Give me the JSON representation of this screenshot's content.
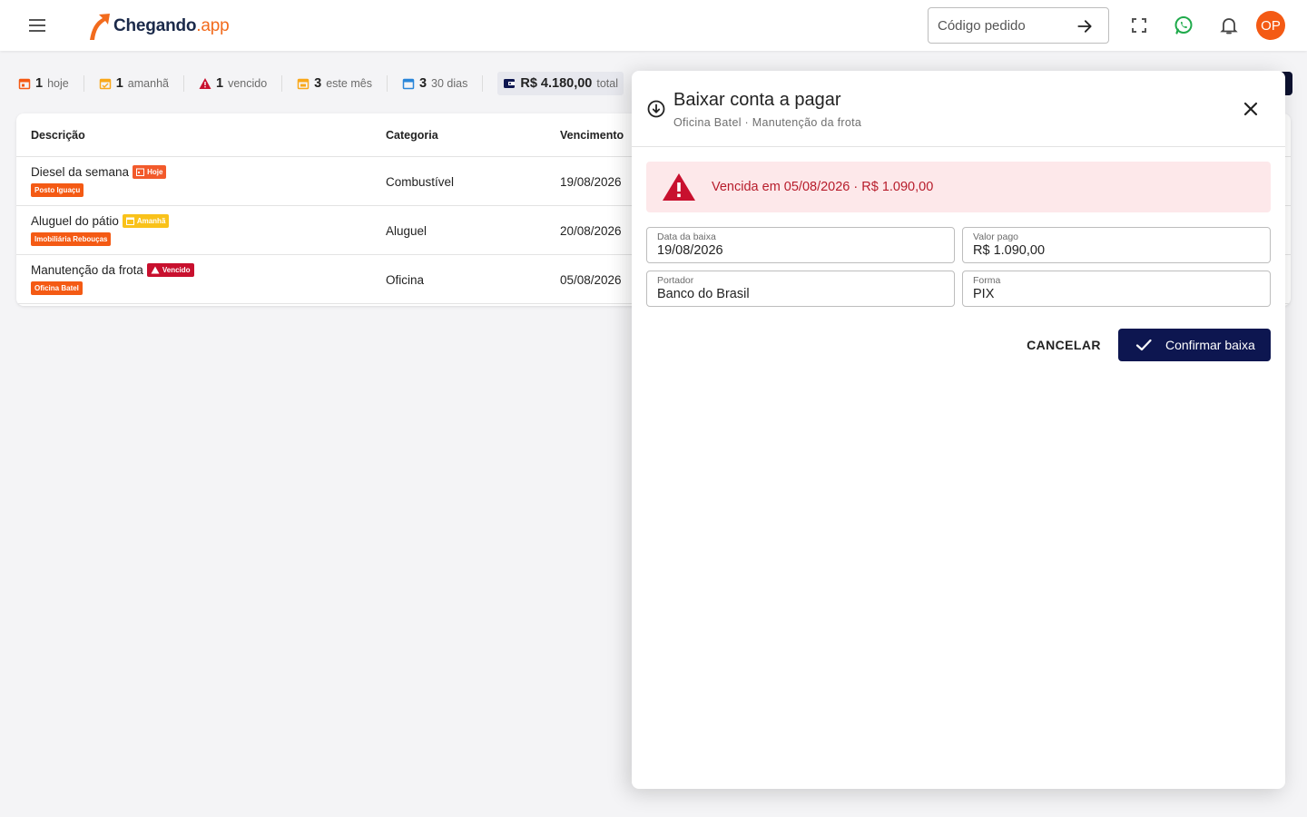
{
  "header": {
    "logo_brand": "Chegando",
    "logo_suffix": ".app",
    "search_placeholder": "Código pedido",
    "avatar_initials": "OP"
  },
  "summary": [
    {
      "count": "1",
      "label": "hoje",
      "icon": "calendar-today-icon",
      "color": "#f45a14"
    },
    {
      "count": "1",
      "label": "amanhã",
      "icon": "calendar-tomorrow-icon",
      "color": "#f9a81a"
    },
    {
      "count": "1",
      "label": "vencido",
      "icon": "warning-icon",
      "color": "#c8102e"
    },
    {
      "count": "3",
      "label": "este mês",
      "icon": "calendar-month-icon",
      "color": "#f9a81a"
    },
    {
      "count": "3",
      "label": "30 dias",
      "icon": "calendar-30-icon",
      "color": "#2a86d9"
    },
    {
      "count": "R$ 4.180,00",
      "label": "total",
      "icon": "wallet-icon",
      "color": "#0d1650"
    }
  ],
  "table": {
    "headers": {
      "description": "Descrição",
      "category": "Categoria",
      "due": "Vencimento"
    },
    "rows": [
      {
        "description": "Diesel da semana",
        "badge": "Hoje",
        "vendor": "Posto Iguaçu",
        "category": "Combustível",
        "due": "19/08/2026"
      },
      {
        "description": "Aluguel do pátio",
        "badge": "Amanhã",
        "vendor": "Imobiliária Rebouças",
        "category": "Aluguel",
        "due": "20/08/2026"
      },
      {
        "description": "Manutenção da frota",
        "badge": "Vencido",
        "vendor": "Oficina Batel",
        "category": "Oficina",
        "due": "05/08/2026"
      }
    ]
  },
  "dialog": {
    "title": "Baixar conta a pagar",
    "subtitle": "Oficina Batel · Manutenção da frota",
    "alert": "Vencida em 05/08/2026 · R$ 1.090,00",
    "fields": {
      "date_label": "Data da baixa",
      "date_value": "19/08/2026",
      "amount_label": "Valor pago",
      "amount_value": "R$ 1.090,00",
      "holder_label": "Portador",
      "holder_value": "Banco do Brasil",
      "method_label": "Forma",
      "method_value": "PIX"
    },
    "cancel_label": "CANCELAR",
    "confirm_label": "Confirmar baixa"
  },
  "colors": {
    "brand_orange": "#f26b1d",
    "navy": "#0d1650",
    "danger": "#c8102e",
    "alert_bg": "#fde8ea"
  }
}
